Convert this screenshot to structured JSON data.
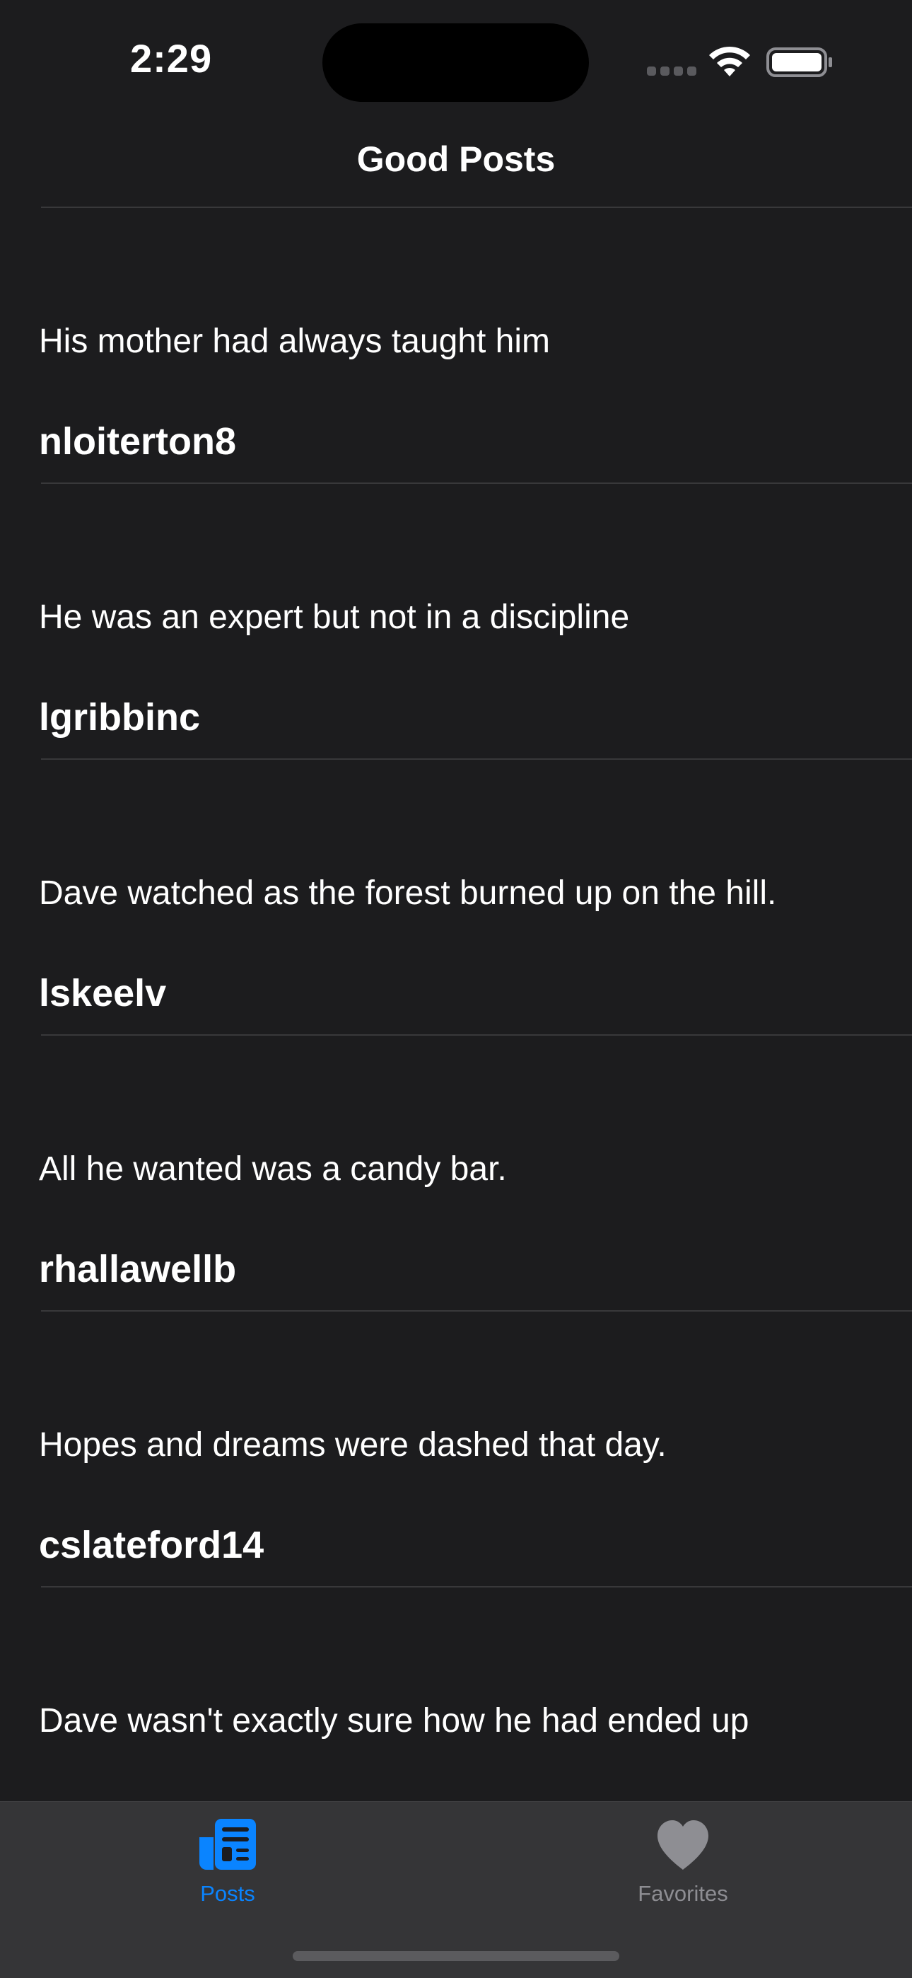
{
  "status_bar": {
    "time": "2:29"
  },
  "nav": {
    "title": "Good Posts"
  },
  "posts": [
    {
      "body": "His mother had always taught him",
      "author": "nloiterton8"
    },
    {
      "body": "He was an expert but not in a discipline",
      "author": "lgribbinc"
    },
    {
      "body": "Dave watched as the forest burned up on the hill.",
      "author": "lskeelv"
    },
    {
      "body": "All he wanted was a candy bar.",
      "author": "rhallawellb"
    },
    {
      "body": "Hopes and dreams were dashed that day.",
      "author": "cslateford14"
    },
    {
      "body": "Dave wasn't exactly sure how he had ended up",
      "author": ""
    }
  ],
  "tab_bar": {
    "tabs": [
      {
        "label": "Posts",
        "icon": "newspaper-icon",
        "selected": true
      },
      {
        "label": "Favorites",
        "icon": "heart-icon",
        "selected": false
      }
    ]
  },
  "colors": {
    "background": "#1c1c1e",
    "tab_bar_background": "#353537",
    "accent": "#0a84ff",
    "inactive": "#8e8e93",
    "divider": "#38383a"
  }
}
